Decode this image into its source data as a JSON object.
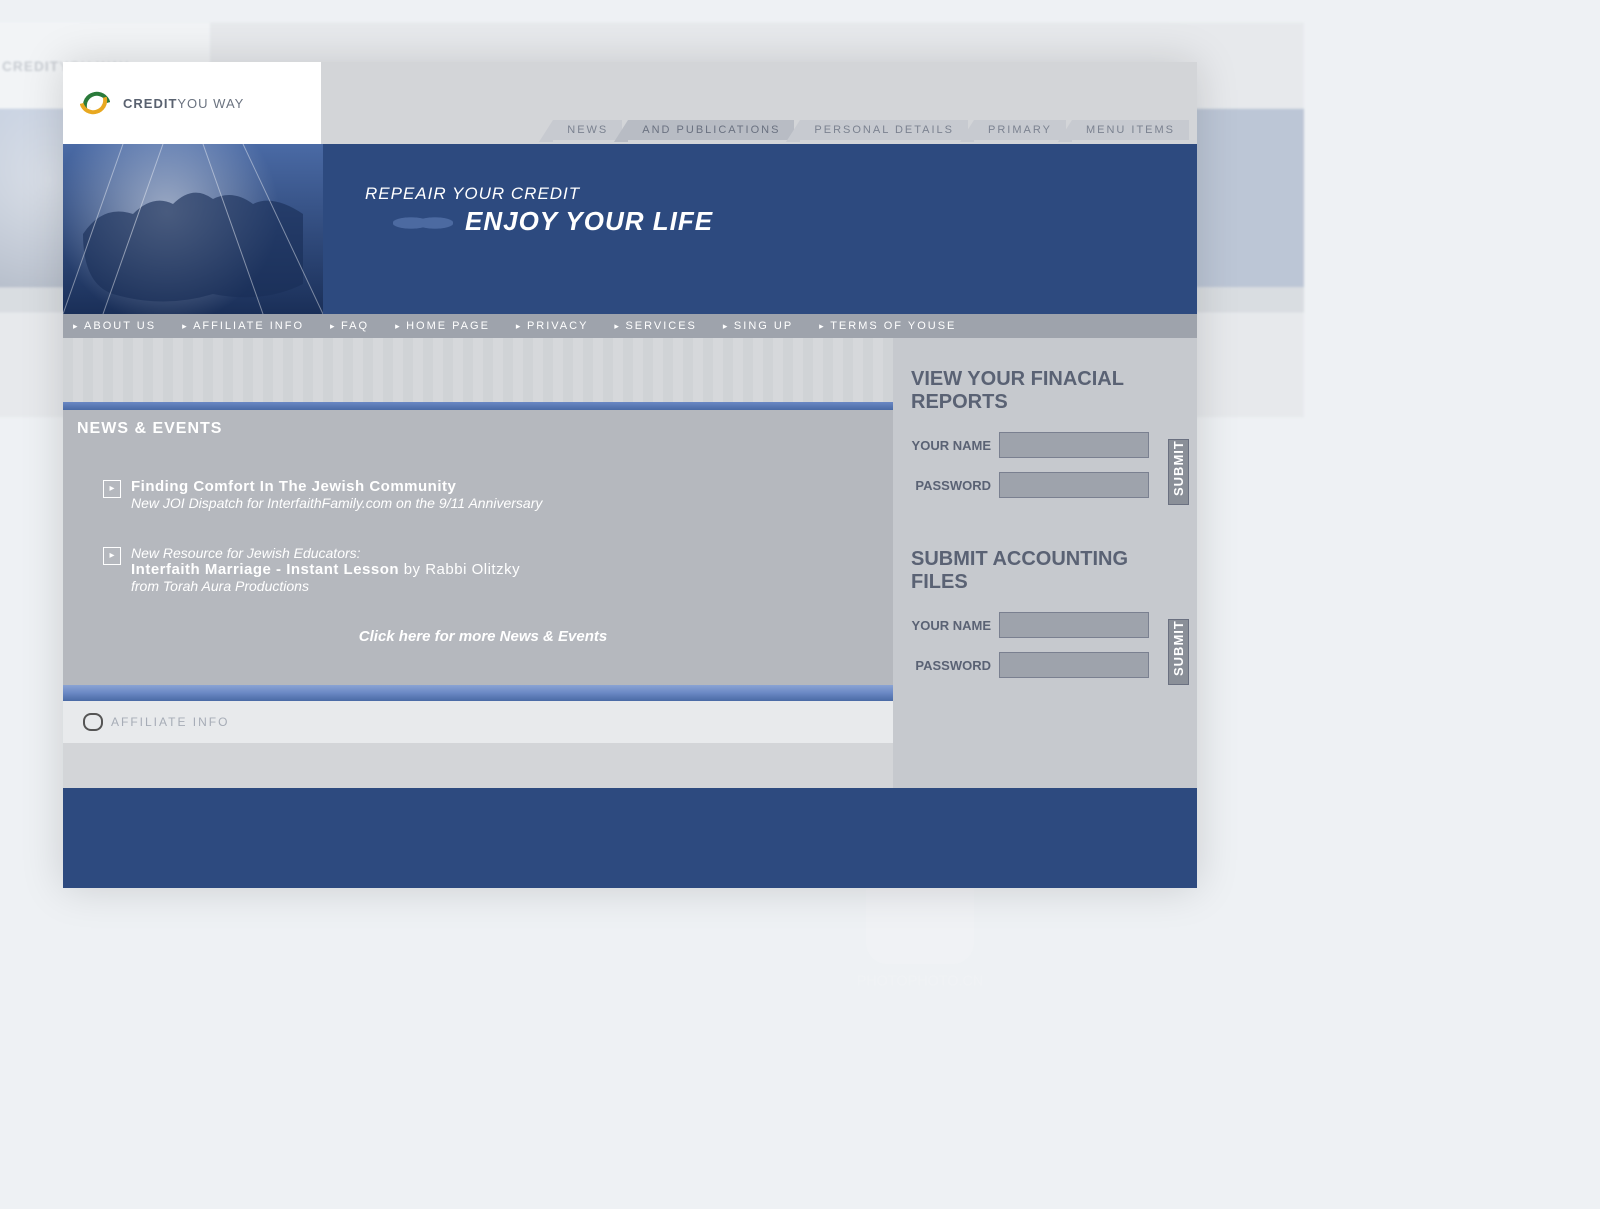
{
  "logo": {
    "bold": "CREDIT",
    "rest": "YOU WAY"
  },
  "top_tabs": [
    {
      "label": "NEWS"
    },
    {
      "label": "AND PUBLICATIONS"
    },
    {
      "label": "PERSONAL DETAILS"
    },
    {
      "label": "PRIMARY"
    },
    {
      "label": "MENU ITEMS"
    }
  ],
  "hero": {
    "subtitle": "REPEAIR YOUR CREDIT",
    "title": "ENJOY YOUR LIFE"
  },
  "nav": [
    "ABOUT US",
    "AFFILIATE INFO",
    "FAQ",
    "HOME PAGE",
    "PRIVACY",
    "SERVICES",
    "SING UP",
    "TERMS OF YOUSE"
  ],
  "news": {
    "heading": "NEWS & EVENTS",
    "items": [
      {
        "title": "Finding Comfort In The Jewish Community",
        "line2_em": "New",
        "line2_rest": " JOI Dispatch for InterfaithFamily.com on the 9/11 Anniversary",
        "line3": ""
      },
      {
        "line1_em": "New Resource for Jewish Educators:",
        "title": "Interfaith Marriage - Instant Lesson",
        "byline": " by Rabbi Olitzky",
        "line3": "from Torah Aura Productions"
      }
    ],
    "more": "Click here for more News & Events"
  },
  "sidebar": {
    "section1": {
      "heading": "VIEW YOUR FINACIAL REPORTS",
      "name_label": "YOUR NAME",
      "pass_label": "PASSWORD",
      "submit": "SUBMIT"
    },
    "section2": {
      "heading": "SUBMIT ACCOUNTING FILES",
      "name_label": "YOUR NAME",
      "pass_label": "PASSWORD",
      "submit": "SUBMIT"
    }
  },
  "affiliate_bar": "AFFILIATE INFO"
}
